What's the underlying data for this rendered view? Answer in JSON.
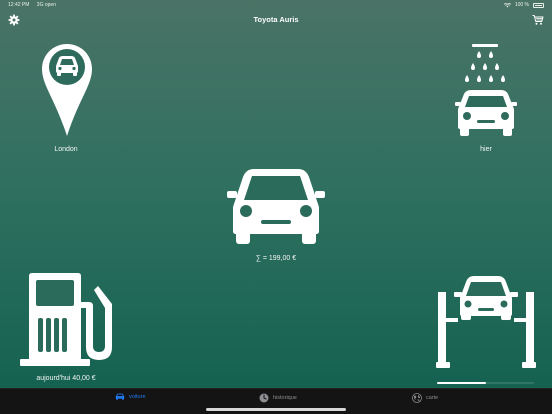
{
  "status": {
    "time": "12:42 PM",
    "carrier": "3G  open",
    "battery": "100 %"
  },
  "header": {
    "title": "Toyota Auris"
  },
  "tiles": {
    "parking_label": "London",
    "wash_label": "hier",
    "total_label": "∑ =  199,00 €",
    "fuel_label": "aujourd'hui 40,00 €"
  },
  "progress": {
    "fraction": 0.5
  },
  "tabs": [
    {
      "label": "voiture",
      "icon": "car-icon"
    },
    {
      "label": "historique",
      "icon": "clock-icon"
    },
    {
      "label": "carte",
      "icon": "globe-icon"
    }
  ],
  "colors": {
    "accent": "#1e7cf2",
    "bg_top": "#4a7366",
    "bg_bottom": "#12604f"
  }
}
